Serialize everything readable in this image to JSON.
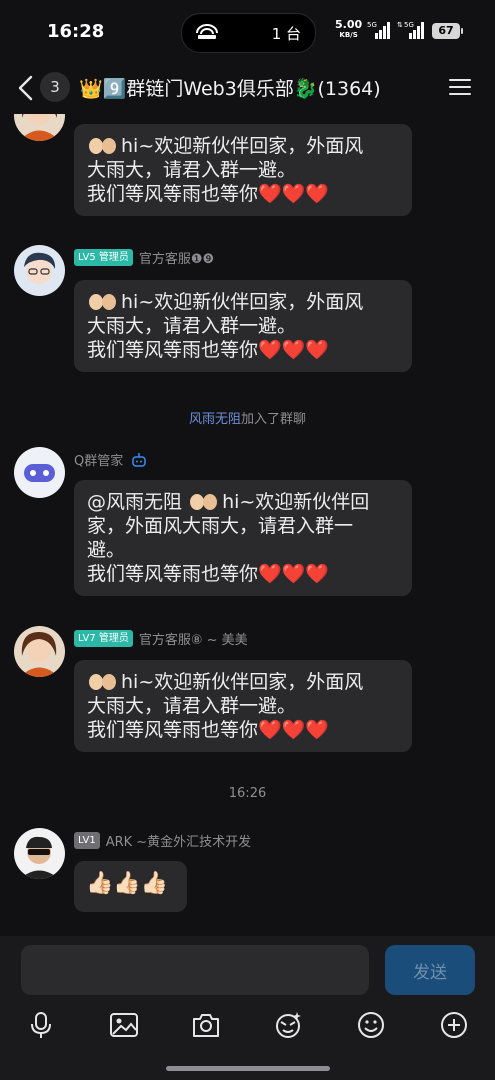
{
  "status_bar": {
    "time": "16:28",
    "island_text": "1 台",
    "net_speed": "5.00",
    "net_unit": "KB/S",
    "sim1": "5G",
    "sim2": "5G",
    "battery": "67"
  },
  "header": {
    "unread_count": "3",
    "title": "👑9️⃣群链门Web3俱乐部🐉(1364)"
  },
  "messages": [
    {
      "lines": [
        "hi~欢迎新伙伴回家，外面风",
        "大雨大，请君入群一避。",
        "我们等风等雨也等你"
      ],
      "hearts": "❤️❤️❤️"
    },
    {
      "level": "LV5 管理员",
      "sender": "官方客服❶❾",
      "lines": [
        "hi~欢迎新伙伴回家，外面风",
        "大雨大，请君入群一避。",
        "我们等风等雨也等你"
      ],
      "hearts": "❤️❤️❤️"
    },
    {
      "sender": "Q群管家",
      "mention": "@风雨无阻",
      "lines": [
        "hi~欢迎新伙伴回",
        "家，外面风大雨大，请君入群一",
        "避。",
        "我们等风等雨也等你"
      ],
      "hearts": "❤️❤️❤️"
    },
    {
      "level": "LV7 管理员",
      "sender": "官方客服⑧ ~ 美美",
      "lines": [
        "hi~欢迎新伙伴回家，外面风",
        "大雨大，请君入群一避。",
        "我们等风等雨也等你"
      ],
      "hearts": "❤️❤️❤️"
    },
    {
      "level": "LV1",
      "sender": "ARK ~黄金外汇技术开发",
      "text": "👍🏻👍🏻👍🏻"
    }
  ],
  "system": {
    "joined_user": "风雨无阻",
    "joined_text": "加入了群聊"
  },
  "timestamp": "16:26",
  "composer": {
    "input_value": "",
    "send_label": "发送"
  },
  "icons": [
    "back-icon",
    "menu-icon",
    "bot-icon",
    "mic-icon",
    "image-icon",
    "camera-icon",
    "sticker-icon",
    "emoji-icon",
    "plus-icon"
  ],
  "colors": {
    "background": "#111113",
    "bubble": "#2a2a2d",
    "admin_badge": "#2cb8a6",
    "link": "#6d8fd8",
    "send_button": "#1a4d7a"
  }
}
